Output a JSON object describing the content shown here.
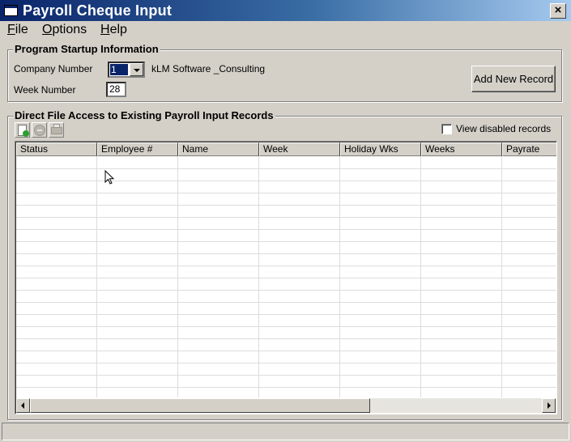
{
  "window": {
    "title": "Payroll Cheque Input",
    "close_glyph": "×"
  },
  "menu": [
    {
      "accel": "F",
      "rest": "ile"
    },
    {
      "accel": "O",
      "rest": "ptions"
    },
    {
      "accel": "H",
      "rest": "elp"
    }
  ],
  "startup": {
    "title": "Program Startup Information",
    "company_label": "Company Number",
    "company_value": "1",
    "company_name": "kLM Software _Consulting",
    "week_label": "Week Number",
    "week_value": "28",
    "add_button": "Add New Record"
  },
  "records": {
    "title": "Direct File Access to Existing Payroll Input Records",
    "view_disabled_label": "View disabled records",
    "view_disabled_checked": false,
    "toolbar_icons": [
      "new-record-icon",
      "delete-record-icon",
      "print-icon"
    ],
    "columns": [
      "Status",
      "Employee #",
      "Name",
      "Week",
      "Holiday Wks",
      "Weeks",
      "Payrate"
    ],
    "rows": []
  },
  "colors": {
    "titlebar_start": "#0a246a",
    "titlebar_end": "#a6caf0",
    "face": "#d4d0c8"
  }
}
